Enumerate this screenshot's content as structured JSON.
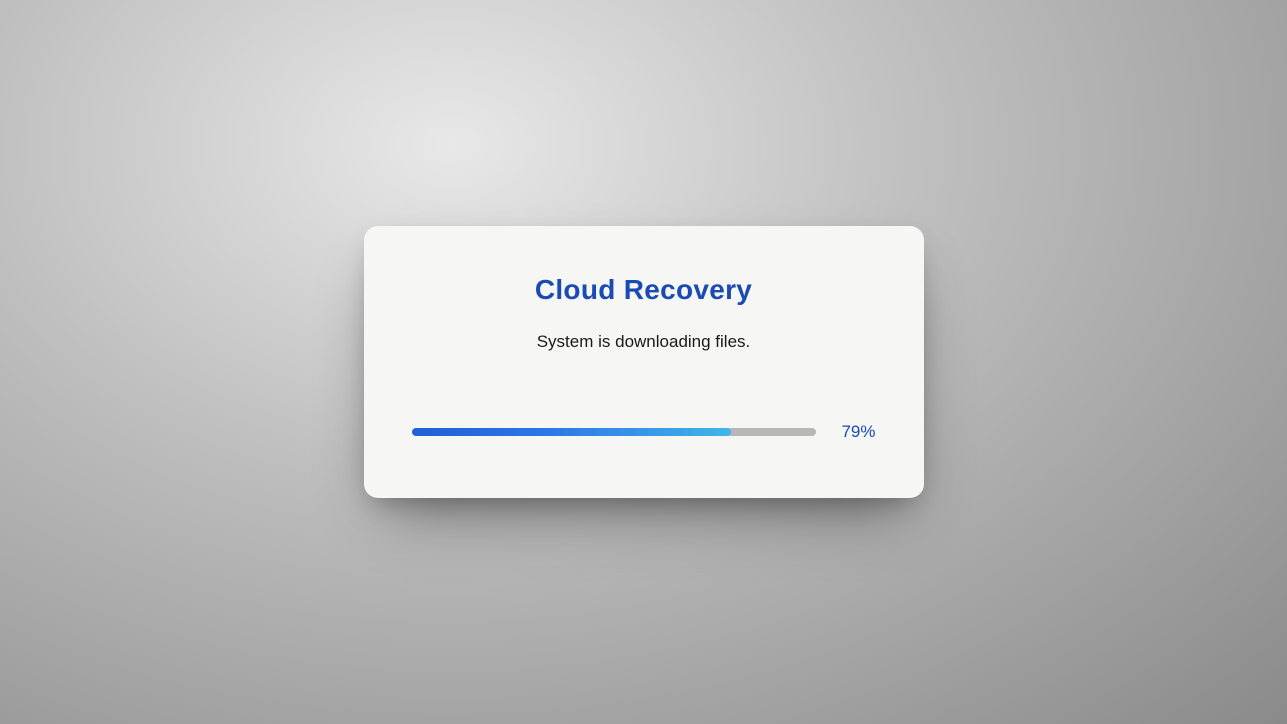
{
  "dialog": {
    "title": "Cloud Recovery",
    "status": "System is downloading files.",
    "progress": {
      "percent": 79,
      "label": "79%"
    }
  },
  "colors": {
    "accent": "#1a4ab4",
    "progress_start": "#1f5fd8",
    "progress_end": "#3fb6e8",
    "track": "#b7b7b7"
  }
}
